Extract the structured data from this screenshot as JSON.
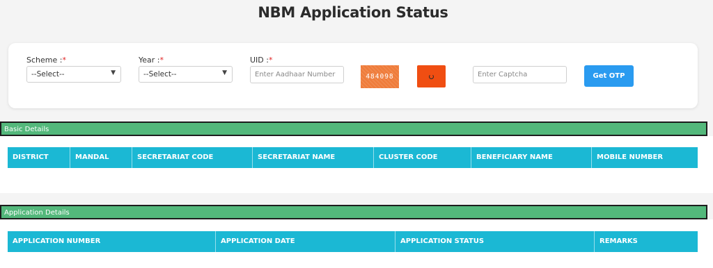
{
  "page": {
    "title": "NBM Application Status"
  },
  "form": {
    "scheme": {
      "label": "Scheme :",
      "required_mark": "*",
      "selected": "--Select--"
    },
    "year": {
      "label": "Year :",
      "required_mark": "*",
      "selected": "--Select--"
    },
    "uid": {
      "label": "UID :",
      "required_mark": "*",
      "placeholder": "Enter Aadhaar Number",
      "value": ""
    },
    "captcha": {
      "code": "484098",
      "placeholder": "Enter Captcha",
      "value": ""
    },
    "refresh_icon": "refresh-icon",
    "get_otp_label": "Get OTP"
  },
  "basic_details": {
    "title": "Basic Details",
    "columns": [
      "DISTRICT",
      "MANDAL",
      "SECRETARIAT CODE",
      "SECRETARIAT NAME",
      "CLUSTER CODE",
      "BENEFICIARY NAME",
      "MOBILE NUMBER"
    ],
    "rows": []
  },
  "application_details": {
    "title": "Application Details",
    "columns": [
      "APPLICATION NUMBER",
      "APPLICATION DATE",
      "APPLICATION STATUS",
      "REMARKS"
    ],
    "rows": []
  },
  "colors": {
    "section_bar": "#53b87b",
    "table_header": "#1bb8d4",
    "otp_button": "#2a9bf0",
    "refresh_button": "#f04e12",
    "captcha_bg": "#ef7d3c",
    "required": "#e02020"
  }
}
